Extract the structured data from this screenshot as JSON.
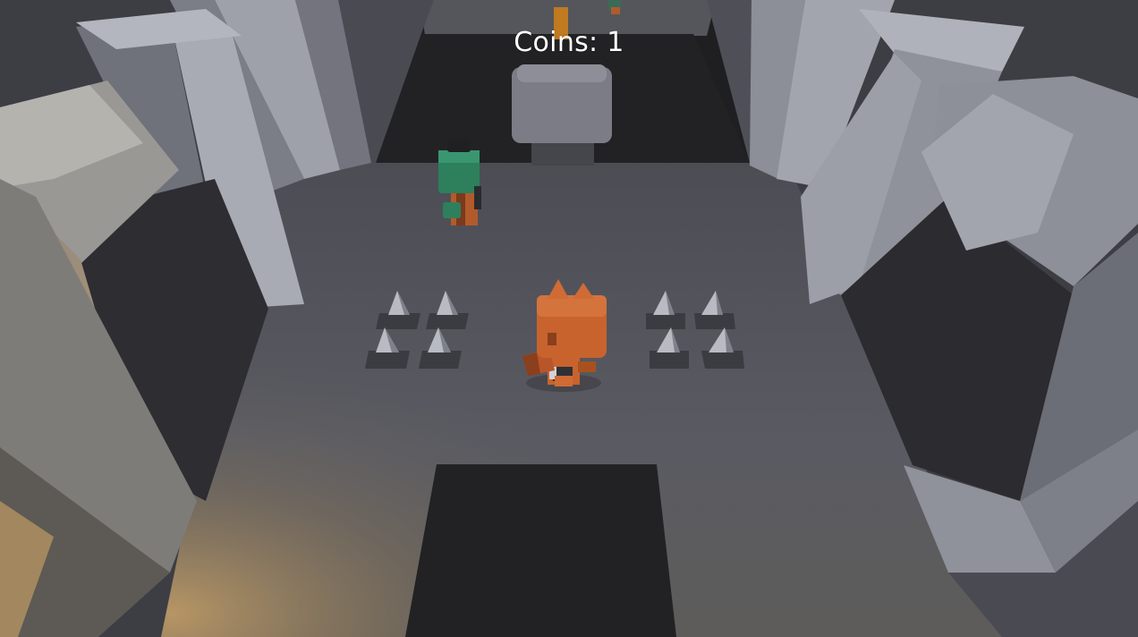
{
  "hud": {
    "coins_label": "Coins: 1"
  },
  "scene": {
    "player": "orange-fox-character",
    "enemy": "green-goblin-character",
    "hazards": "floor-spike-traps"
  },
  "colors": {
    "floor": "#57585f",
    "wall_light": "#8e909b",
    "pit": "#222224",
    "torchlight": "#c7a066",
    "player": "#c8632e",
    "enemy": "#2e7f5c"
  }
}
